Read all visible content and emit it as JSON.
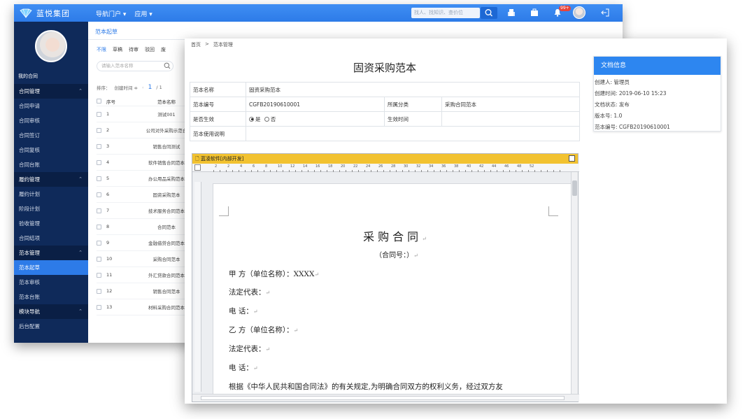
{
  "app": {
    "name": "蓝悦集团",
    "brand_color": "#2d7be8",
    "sidebar_color": "#0f2a5a"
  },
  "topnav": {
    "items": [
      "导航门户 ▾",
      "应用 ▾"
    ],
    "search_placeholder": "找人、找知识、查价位",
    "notif_badge": "99+"
  },
  "sidebar": {
    "my_contract": "我的合同",
    "groups": [
      {
        "label": "合同管理",
        "items": [
          "合同申请",
          "合同审核",
          "合同签订",
          "合同复核",
          "合同台账"
        ]
      },
      {
        "label": "履约管理",
        "items": [
          "履约计划",
          "阶段计划",
          "验收管理",
          "合同结项"
        ]
      },
      {
        "label": "范本管理",
        "items": [
          "范本起草",
          "范本审核",
          "范本台账"
        ]
      },
      {
        "label": "模块导航",
        "items": [
          "后台配置"
        ]
      }
    ],
    "active_item": "范本起草"
  },
  "middle": {
    "tab": "范本起草",
    "filters": [
      "不限",
      "草稿",
      "待审",
      "驳回",
      "废"
    ],
    "search_placeholder": "请输入范本名称",
    "sort_label": "排序：",
    "sort_value": "创建时间 ≑",
    "page_current": "1",
    "page_total": "/ 1",
    "columns": [
      "序号",
      "范本名称"
    ],
    "rows": [
      {
        "no": "1",
        "name": "测试001"
      },
      {
        "no": "2",
        "name": "公司对外采购示范合"
      },
      {
        "no": "3",
        "name": "销售合同测试"
      },
      {
        "no": "4",
        "name": "软件销售合同范本"
      },
      {
        "no": "5",
        "name": "办公用品采购范本"
      },
      {
        "no": "6",
        "name": "固资采购范本"
      },
      {
        "no": "7",
        "name": "技术服务合同范本"
      },
      {
        "no": "8",
        "name": "合同范本"
      },
      {
        "no": "9",
        "name": "金融借贷合同范本"
      },
      {
        "no": "10",
        "name": "采购合同范本"
      },
      {
        "no": "11",
        "name": "外汇贷款合同范本"
      },
      {
        "no": "12",
        "name": "销售合同范本"
      },
      {
        "no": "13",
        "name": "材料采购合同范本"
      }
    ]
  },
  "detail": {
    "breadcrumb": [
      "首页",
      ">",
      "范本管理"
    ],
    "title": "固资采购范本",
    "form": {
      "name_label": "范本名称",
      "name_value": "固资采购范本",
      "code_label": "范本编号",
      "code_value": "CGFB20190610001",
      "category_label": "所属分类",
      "category_value": "采购合同范本",
      "effective_label": "是否生效",
      "yes": "是",
      "no": "否",
      "effective_time_label": "生效时间",
      "desc_label": "范本使用说明"
    },
    "editor": {
      "bar_label": "蓝凌软件[内部开发]",
      "ruler_numbers": [
        "2",
        "2",
        "4",
        "6",
        "8",
        "10",
        "12",
        "14",
        "16",
        "18",
        "20",
        "22",
        "24",
        "26",
        "28",
        "30",
        "32",
        "34",
        "36",
        "38",
        "40",
        "42",
        "44",
        "46",
        "48",
        "52"
      ],
      "doc": {
        "title": "采购合同",
        "subtitle": "（合同号：）",
        "lines": [
          "甲  方（单位名称）：XXXX",
          "法定代表：",
          "电  话：",
          "乙  方（单位名称）：",
          "法定代表：",
          "电  话：",
          "根据《中华人民共和国合同法》的有关规定,为明确合同双方的权利义务，经过双方友"
        ]
      }
    }
  },
  "info": {
    "header": "文档信息",
    "rows": [
      "创建人: 管理员",
      "创建时间: 2019-06-10 15:23",
      "文档状态: 发布",
      "版本号: 1.0",
      "范本编号: CGFB20190610001"
    ]
  }
}
